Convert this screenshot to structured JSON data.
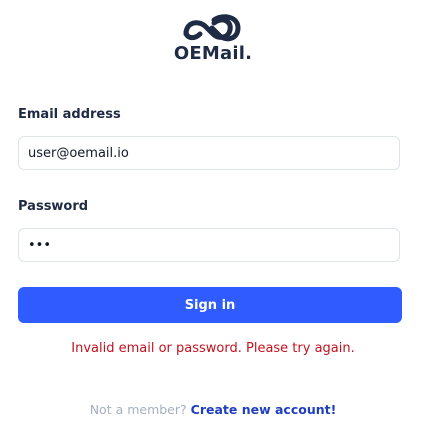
{
  "brand": {
    "name": "OEMail."
  },
  "form": {
    "email_label": "Email address",
    "email_value": "user@oemail.io",
    "password_label": "Password",
    "password_value": "•••",
    "signin_label": "Sign in",
    "error_message": "Invalid email or password. Please try again."
  },
  "footer": {
    "prompt": "Not a member?",
    "link_label": "Create new account!"
  },
  "colors": {
    "primary": "#2f5bff",
    "text_dark": "#1f2a44",
    "error": "#c1121f",
    "muted": "#a7b0c0",
    "link": "#1f3fbf"
  },
  "icons": {
    "logo": "infinity-logo-icon"
  }
}
